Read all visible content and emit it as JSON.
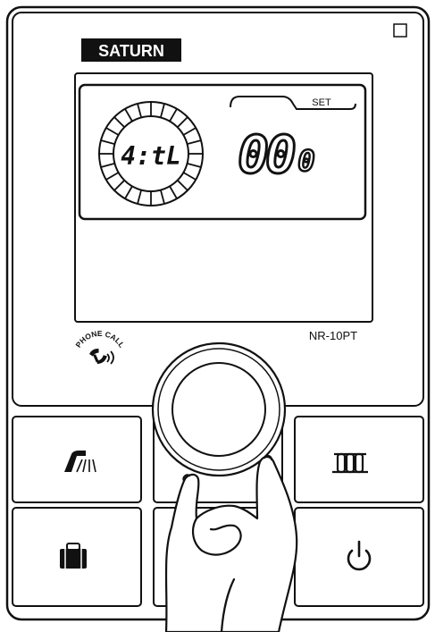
{
  "device": {
    "brand": "SATURN",
    "model": "NR-10PT",
    "phone_call_label": "PHONE CALL",
    "colors": {
      "outline": "#111111",
      "background": "#ffffff"
    }
  },
  "display": {
    "clock_text": "4:tL",
    "set_label": "SET",
    "temperature_main": "00",
    "temperature_small": "0"
  },
  "controls": {
    "buttons": [
      {
        "id": "shower",
        "icon": "shower-icon"
      },
      {
        "id": "radiator",
        "icon": "radiator-icon"
      },
      {
        "id": "vacation",
        "icon": "suitcase-icon"
      },
      {
        "id": "power",
        "icon": "power-icon"
      }
    ],
    "dial": {
      "icon": "rotary-knob"
    }
  }
}
